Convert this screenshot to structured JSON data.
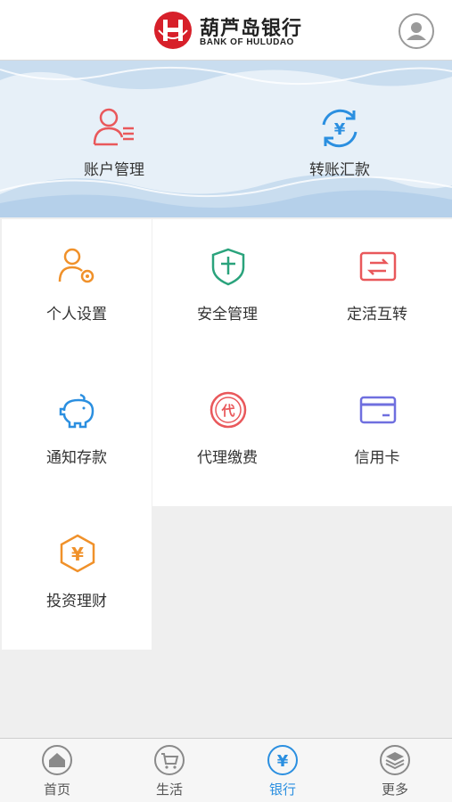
{
  "header": {
    "logo_cn": "葫芦岛银行",
    "logo_en": "BANK OF HULUDAO"
  },
  "banner": {
    "items": [
      {
        "label": "账户管理",
        "icon": "account-manage-icon"
      },
      {
        "label": "转账汇款",
        "icon": "transfer-icon"
      }
    ]
  },
  "grid": {
    "items": [
      {
        "label": "个人设置",
        "icon": "personal-settings-icon"
      },
      {
        "label": "安全管理",
        "icon": "shield-icon"
      },
      {
        "label": "定活互转",
        "icon": "exchange-icon"
      },
      {
        "label": "通知存款",
        "icon": "piggy-bank-icon"
      },
      {
        "label": "代理缴费",
        "icon": "agent-payment-icon"
      },
      {
        "label": "信用卡",
        "icon": "credit-card-icon"
      },
      {
        "label": "投资理财",
        "icon": "investment-icon"
      }
    ]
  },
  "tabbar": {
    "items": [
      {
        "label": "首页",
        "icon": "home-icon",
        "active": false
      },
      {
        "label": "生活",
        "icon": "cart-icon",
        "active": false
      },
      {
        "label": "银行",
        "icon": "yuan-icon",
        "active": true
      },
      {
        "label": "更多",
        "icon": "layers-icon",
        "active": false
      }
    ]
  },
  "colors": {
    "brand_red": "#d7202a",
    "active_blue": "#2b8fe0",
    "icon_red": "#e9585b",
    "icon_orange": "#f0912a",
    "icon_green": "#2aa37c",
    "icon_blue": "#2b8fe0",
    "icon_purple": "#6f6fdf"
  }
}
